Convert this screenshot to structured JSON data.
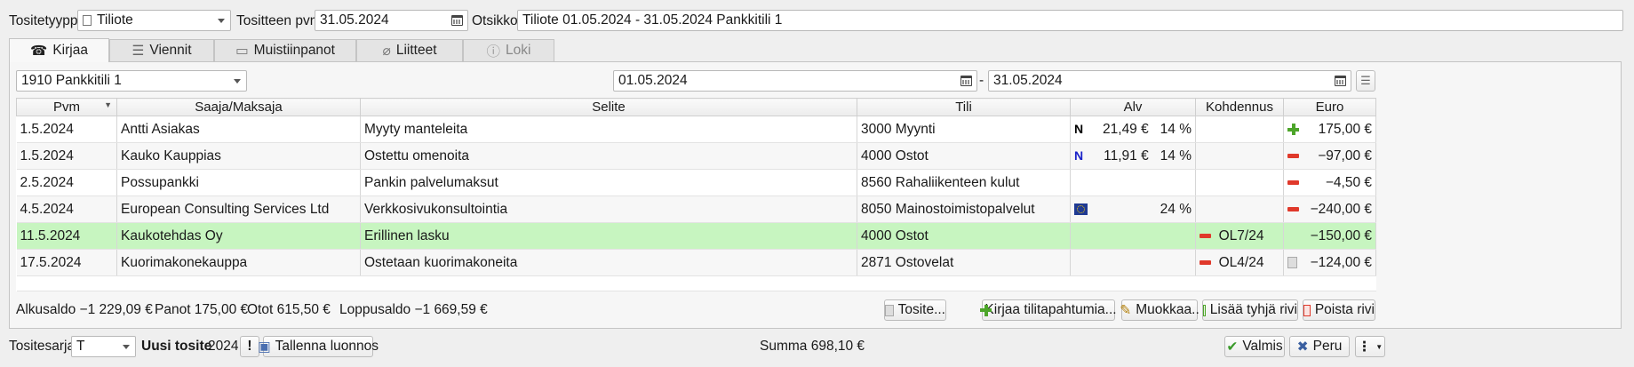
{
  "header": {
    "type_label": "Tositetyyppi",
    "type_value": "Tiliote",
    "date_label": "Tositteen pvm",
    "date_value": "31.05.2024",
    "title_label": "Otsikko",
    "title_value": "Tiliote 01.05.2024 - 31.05.2024 Pankkitili 1"
  },
  "tabs": [
    {
      "label": "Kirjaa",
      "icon": "phone-icon",
      "active": true
    },
    {
      "label": "Viennit",
      "icon": "list-icon"
    },
    {
      "label": "Muistiinpanot",
      "icon": "note-icon"
    },
    {
      "label": "Liitteet",
      "icon": "paperclip-icon"
    },
    {
      "label": "Loki",
      "icon": "info-icon",
      "disabled": true
    }
  ],
  "filter": {
    "account": "1910 Pankkitili 1",
    "start_date": "01.05.2024",
    "separator": "-",
    "end_date": "31.05.2024"
  },
  "columns": [
    "Pvm",
    "Saaja/Maksaja",
    "Selite",
    "Tili",
    "Alv",
    "Kohdennus",
    "Euro"
  ],
  "rows": [
    {
      "date": "1.5.2024",
      "party": "Antti Asiakas",
      "desc": "Myyty manteleita",
      "account": "3000 Myynti",
      "vat_badge": "N",
      "vat_amount": "21,49 €",
      "vat_pct": "14 %",
      "target": "",
      "type_icon": "plus-icon",
      "euro": "175,00 €"
    },
    {
      "date": "1.5.2024",
      "party": "Kauko Kauppias",
      "desc": "Ostettu omenoita",
      "account": "4000 Ostot",
      "vat_badge": "N",
      "vat_amount": "11,91 €",
      "vat_pct": "14 %",
      "target": "",
      "type_icon": "minus-icon",
      "euro": "−97,00 €"
    },
    {
      "date": "2.5.2024",
      "party": "Possupankki",
      "desc": "Pankin palvelumaksut",
      "account": "8560 Rahaliikenteen kulut",
      "vat_badge": "",
      "vat_amount": "",
      "vat_pct": "",
      "target": "",
      "type_icon": "minus-icon",
      "euro": "−4,50 €"
    },
    {
      "date": "4.5.2024",
      "party": "European Consulting Services Ltd",
      "desc": "Verkkosivukonsultointia",
      "account": "8050 Mainostoimistopalvelut",
      "vat_badge": "eu-flag-icon",
      "vat_amount": "",
      "vat_pct": "24 %",
      "target": "",
      "type_icon": "minus-icon",
      "euro": "−240,00 €"
    },
    {
      "date": "11.5.2024",
      "party": "Kaukotehdas Oy",
      "desc": "Erillinen lasku",
      "account": "4000 Ostot",
      "vat_badge": "",
      "vat_amount": "",
      "vat_pct": "",
      "target": "OL7/24",
      "type_icon": "",
      "euro": "−150,00 €"
    },
    {
      "date": "17.5.2024",
      "party": "Kuorimakonekauppa",
      "desc": "Ostetaan kuorimakoneita",
      "account": "2871 Ostovelat",
      "vat_badge": "",
      "vat_amount": "",
      "vat_pct": "",
      "target": "OL4/24",
      "type_icon": "document-icon",
      "euro": "−124,00 €"
    }
  ],
  "summary": {
    "start_balance": "Alkusaldo −1 229,09 €",
    "deposits": "Panot 175,00 €",
    "withdrawals": "Otot 615,50 €",
    "end_balance": "Loppusaldo −1 669,59 €"
  },
  "actions": {
    "voucher": "Tosite...",
    "record_events": "Kirjaa tilitapahtumia...",
    "edit": "Muokkaa..",
    "add_empty_row": "Lisää tyhjä rivi",
    "delete_row": "Poista rivi"
  },
  "footer": {
    "series_label": "Tositesarja",
    "series_value": "T",
    "new_voucher": "Uusi tosite",
    "year": "2024",
    "save_draft": "Tallenna luonnos",
    "sum": "Summa 698,10 €",
    "ok": "Valmis",
    "cancel": "Peru"
  },
  "colors": {
    "selected_row": "#c7f5c0",
    "minus": "#e0392b",
    "plus": "#4da52a",
    "vat_badge": "#1a22c8"
  }
}
